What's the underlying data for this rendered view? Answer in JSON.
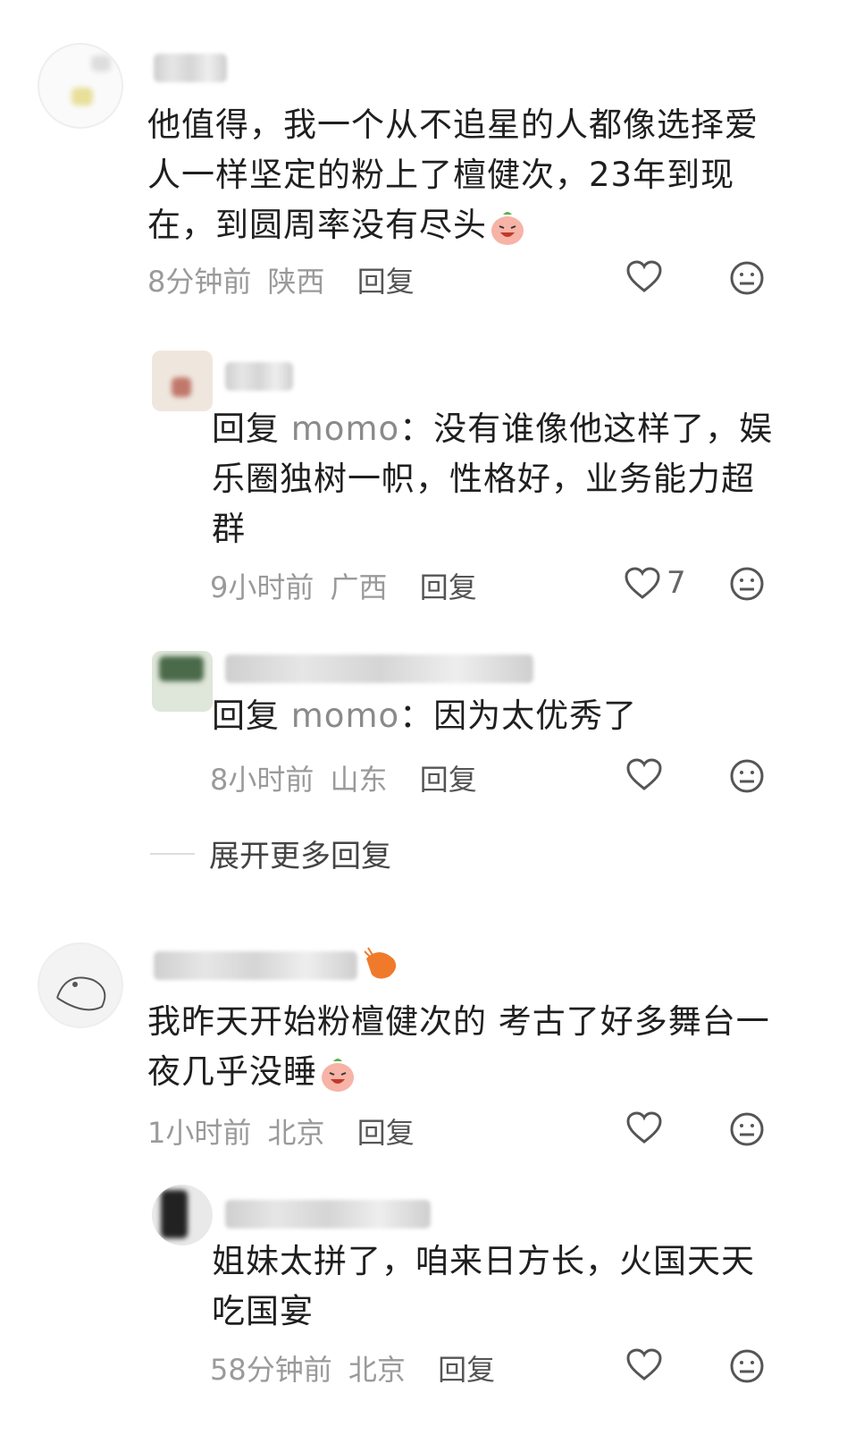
{
  "comments": [
    {
      "text": "他值得，我一个从不追星的人都像选择爱人一样坚定的粉上了檀健次，23年到现在，到圆周率没有尽头",
      "time": "8分钟前",
      "location": "陕西",
      "reply_label": "回复",
      "likes": ""
    },
    {
      "reply_prefix": "回复",
      "mention": "momo",
      "text": "：没有谁像他这样了，娱乐圈独树一帜，性格好，业务能力超群",
      "time": "9小时前",
      "location": "广西",
      "reply_label": "回复",
      "likes": "7"
    },
    {
      "reply_prefix": "回复",
      "mention": "momo",
      "text": "：因为太优秀了",
      "time": "8小时前",
      "location": "山东",
      "reply_label": "回复",
      "likes": ""
    },
    {
      "text": "我昨天开始粉檀健次的 考古了好多舞台一夜几乎没睡",
      "time": "1小时前",
      "location": "北京",
      "reply_label": "回复",
      "likes": ""
    },
    {
      "text": "姐妹太拼了，咱来日方长，火国天天吃国宴",
      "time": "58分钟前",
      "location": "北京",
      "reply_label": "回复",
      "likes": ""
    }
  ],
  "expand_more": "展开更多回复",
  "icons": {
    "like": "heart-outline-icon",
    "dislike": "neutral-face-icon",
    "emoji": "laughing-tomato-emoji",
    "badge": "shrimp-icon"
  },
  "colors": {
    "text": "#1f1f1f",
    "meta": "#9a9a9a",
    "icon": "#555555"
  }
}
